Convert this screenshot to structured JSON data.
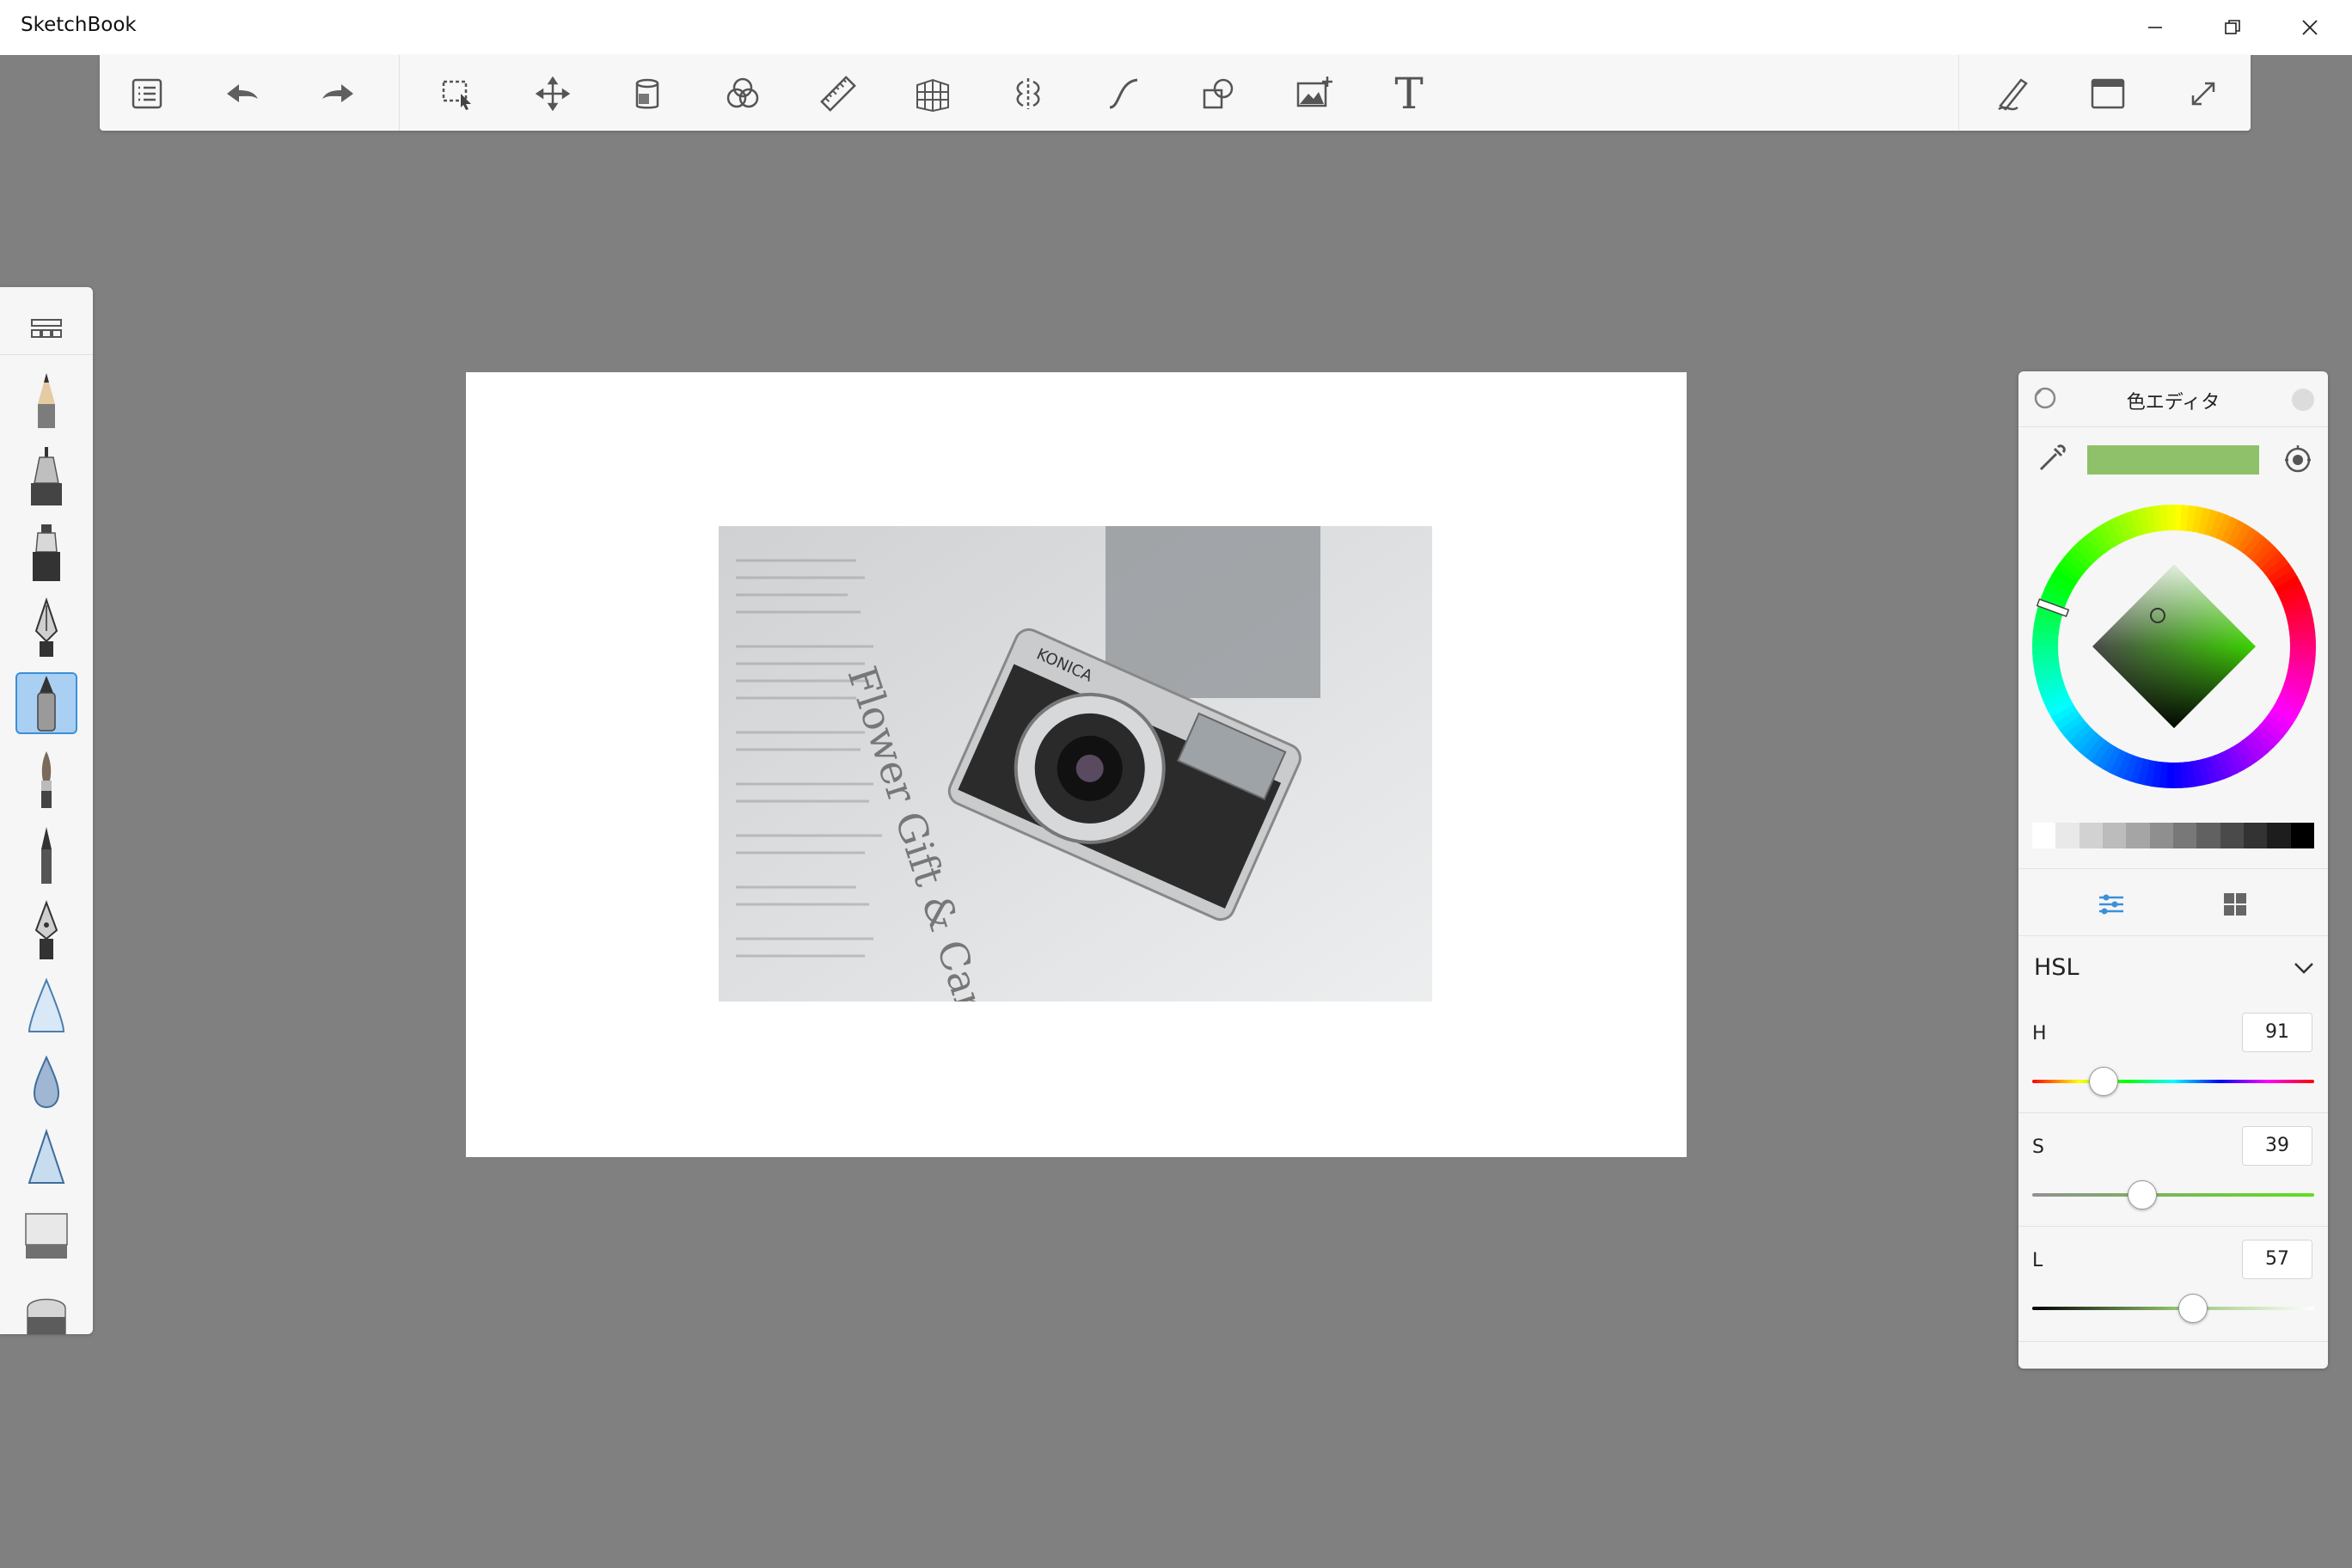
{
  "window": {
    "title": "SketchBook",
    "controls": [
      "minimize-icon",
      "restore-icon",
      "close-icon"
    ]
  },
  "toolbar": {
    "left_tools": [
      "menu-list-icon",
      "undo-icon",
      "redo-icon"
    ],
    "main_tools": [
      "selection-icon",
      "move-transform-icon",
      "copy-paste-icon",
      "layer-blend-icon",
      "ruler-icon",
      "perspective-icon",
      "symmetry-icon",
      "stroke-curve-icon",
      "shapes-icon",
      "add-image-icon",
      "text-icon"
    ],
    "text_tool_glyph": "T",
    "right_tools": [
      "brush-settings-icon",
      "ui-toggle-icon",
      "fullscreen-icon"
    ]
  },
  "brush_palette": {
    "library_icon": "brush-library-icon",
    "brushes": [
      "pencil",
      "technical-pen",
      "marker",
      "ballpoint-pen",
      "ink-pen",
      "paint-brush",
      "fine-pen",
      "fountain-pen",
      "airbrush",
      "water-drop",
      "hard-airbrush",
      "eraser-block",
      "soft-eraser"
    ],
    "active_index": 4
  },
  "canvas": {
    "background": "#ffffff",
    "image": "photo-camera-on-newspaper",
    "photo_text": {
      "brand": "KONICA",
      "newspaper_headline": "Flower Gift & Card S"
    }
  },
  "color_editor": {
    "title": "色エディタ",
    "current_color": "#8ec16a",
    "grayscale_swatches": [
      "#ffffff",
      "#e9e9e9",
      "#d2d2d2",
      "#bcbcbc",
      "#a5a5a5",
      "#8f8f8f",
      "#787878",
      "#616161",
      "#4a4a4a",
      "#333333",
      "#1d1d1d",
      "#000000"
    ],
    "mode": "HSL",
    "sliders": [
      {
        "label": "H",
        "value": "91",
        "fraction": 0.253
      },
      {
        "label": "S",
        "value": "39",
        "fraction": 0.39
      },
      {
        "label": "L",
        "value": "57",
        "fraction": 0.57
      }
    ]
  }
}
